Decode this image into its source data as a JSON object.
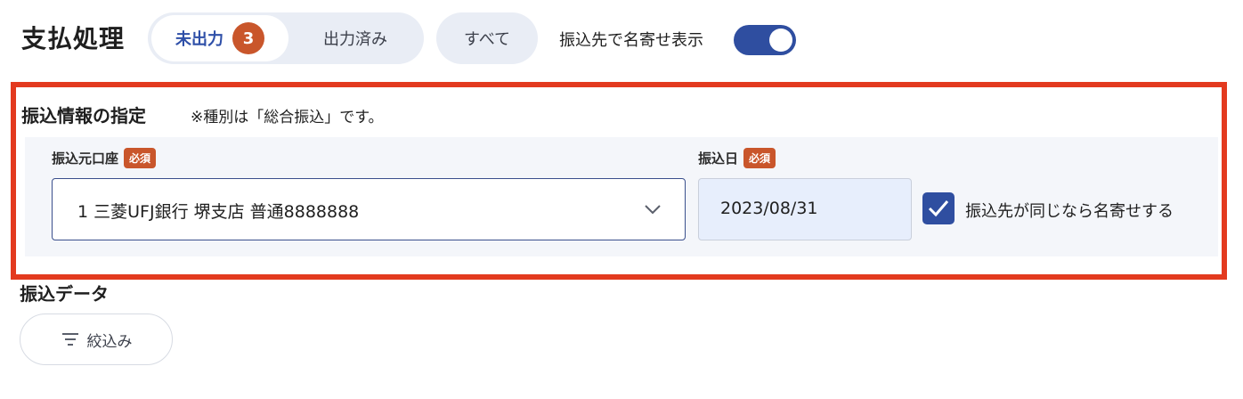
{
  "header": {
    "title": "支払処理",
    "tabs": [
      {
        "label": "未出力",
        "badge": "3"
      },
      {
        "label": "出力済み"
      },
      {
        "label": "すべて"
      }
    ],
    "toggle": {
      "label": "振込先で名寄せ表示",
      "on": true
    }
  },
  "transfer_section": {
    "title": "振込情報の指定",
    "note": "※種別は「総合振込」です。",
    "account": {
      "label": "振込元口座",
      "required": "必須",
      "value": "1 三菱UFJ銀行 堺支店 普通8888888"
    },
    "date": {
      "label": "振込日",
      "required": "必須",
      "value": "2023/08/31"
    },
    "merge_checkbox": {
      "label": "振込先が同じなら名寄せする",
      "checked": true
    }
  },
  "data_section": {
    "title": "振込データ",
    "filter_label": "絞込み"
  },
  "colors": {
    "accent": "#2f4ea0",
    "badge": "#c9562b",
    "highlight": "#e33a1f"
  }
}
